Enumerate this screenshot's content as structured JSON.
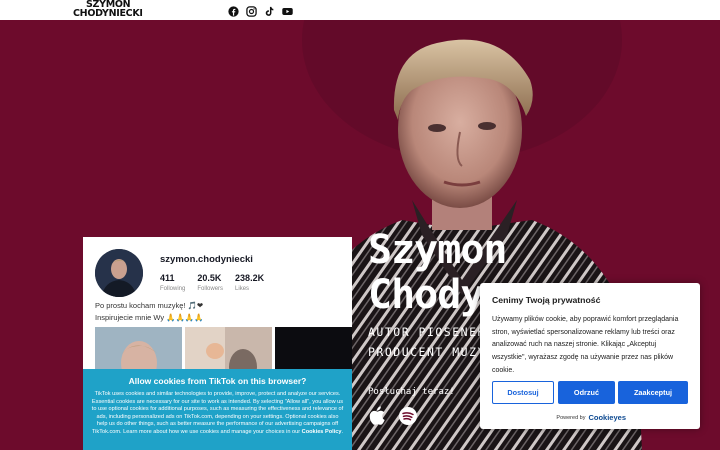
{
  "header": {
    "logo_line1": "SZYMON",
    "logo_line2": "CHODYNIECKI",
    "social_icons": [
      "facebook-icon",
      "instagram-icon",
      "tiktok-icon",
      "youtube-icon"
    ]
  },
  "hero": {
    "name_line1": "Szymon",
    "name_line2": "Chody",
    "role_line1": "AUTOR PIOSENEK",
    "role_line2": "PRODUCENT MUZYCZ",
    "listen_label": "Posłuchaj teraz!",
    "platform_icons": [
      "apple-music-icon",
      "spotify-icon"
    ],
    "background_color": "#6d0b2c"
  },
  "tiktok_widget": {
    "handle": "szymon.chodyniecki",
    "stats": [
      {
        "value": "411",
        "label": "Following"
      },
      {
        "value": "20.5K",
        "label": "Followers"
      },
      {
        "value": "238.2K",
        "label": "Likes"
      }
    ],
    "bio_line1": "Po prostu kocham muzykę! 🎵❤",
    "bio_line2": "Inspirujecie mnie Wy 🙏🙏🙏🙏",
    "cookie_title": "Allow cookies from TikTok on this browser?",
    "cookie_text": "TikTok uses cookies and similar technologies to provide, improve, protect and analyze our services. Essential cookies are necessary for our site to work as intended. By selecting \"Allow all\", you allow us to use optional cookies for additional purposes, such as measuring the effectiveness and relevance of ads, including personalized ads on TikTok.com, depending on your settings. Optional cookies also help us do other things, such as better measure the performance of our advertising campaigns off TikTok.com. Learn more about how we use cookies and manage your choices in our",
    "cookie_policy_link": "Cookies Policy",
    "cookie_color": "#1fa2c8"
  },
  "consent": {
    "title": "Cenimy Twoją prywatność",
    "description": "Używamy plików cookie, aby poprawić komfort przeglądania stron, wyświetlać spersonalizowane reklamy lub treści oraz analizować ruch na naszej stronie. Klikając „Akceptuj wszystkie\", wyrażasz zgodę na używanie przez nas plików cookie.",
    "btn_customize": "Dostosuj",
    "btn_reject": "Odrzuć",
    "btn_accept": "Zaakceptuj",
    "powered_by": "Powered by",
    "brand": "Cookieyes",
    "accent_color": "#1863dc"
  }
}
